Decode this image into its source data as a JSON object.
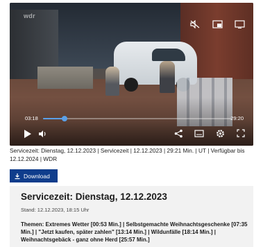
{
  "player": {
    "brand_text": "wdr",
    "current_time": "03:18",
    "total_time": "29:20",
    "progress": 0.113,
    "accent_color": "#5aa0e8",
    "top_icons": [
      "mute-icon",
      "picture-in-picture-icon",
      "cast-icon"
    ],
    "bottom_icons": [
      "share-icon",
      "subtitles-icon",
      "settings-icon",
      "fullscreen-icon"
    ]
  },
  "meta": {
    "line": "Servicezeit: Dienstag, 12.12.2023 | Servicezeit | 12.12.2023 | 29:21 Min. | UT | Verfügbar bis 12.12.2024 | WDR"
  },
  "download": {
    "label": "Download",
    "color": "#0f3d8c"
  },
  "card": {
    "title": "Servicezeit: Dienstag, 12.12.2023",
    "date": "Stand: 12.12.2023, 18:15 Uhr",
    "topics": "Themen: Extremes Wetter [00:53 Min.] | Selbstgemachte Weihnachtsgeschenke [07:35 Min.] | \"Jetzt kaufen, später zahlen\" [13:14 Min.] | Wildunfälle [18:14 Min.] | Weihnachtsgebäck - ganz ohne Herd [25:57 Min.]"
  }
}
